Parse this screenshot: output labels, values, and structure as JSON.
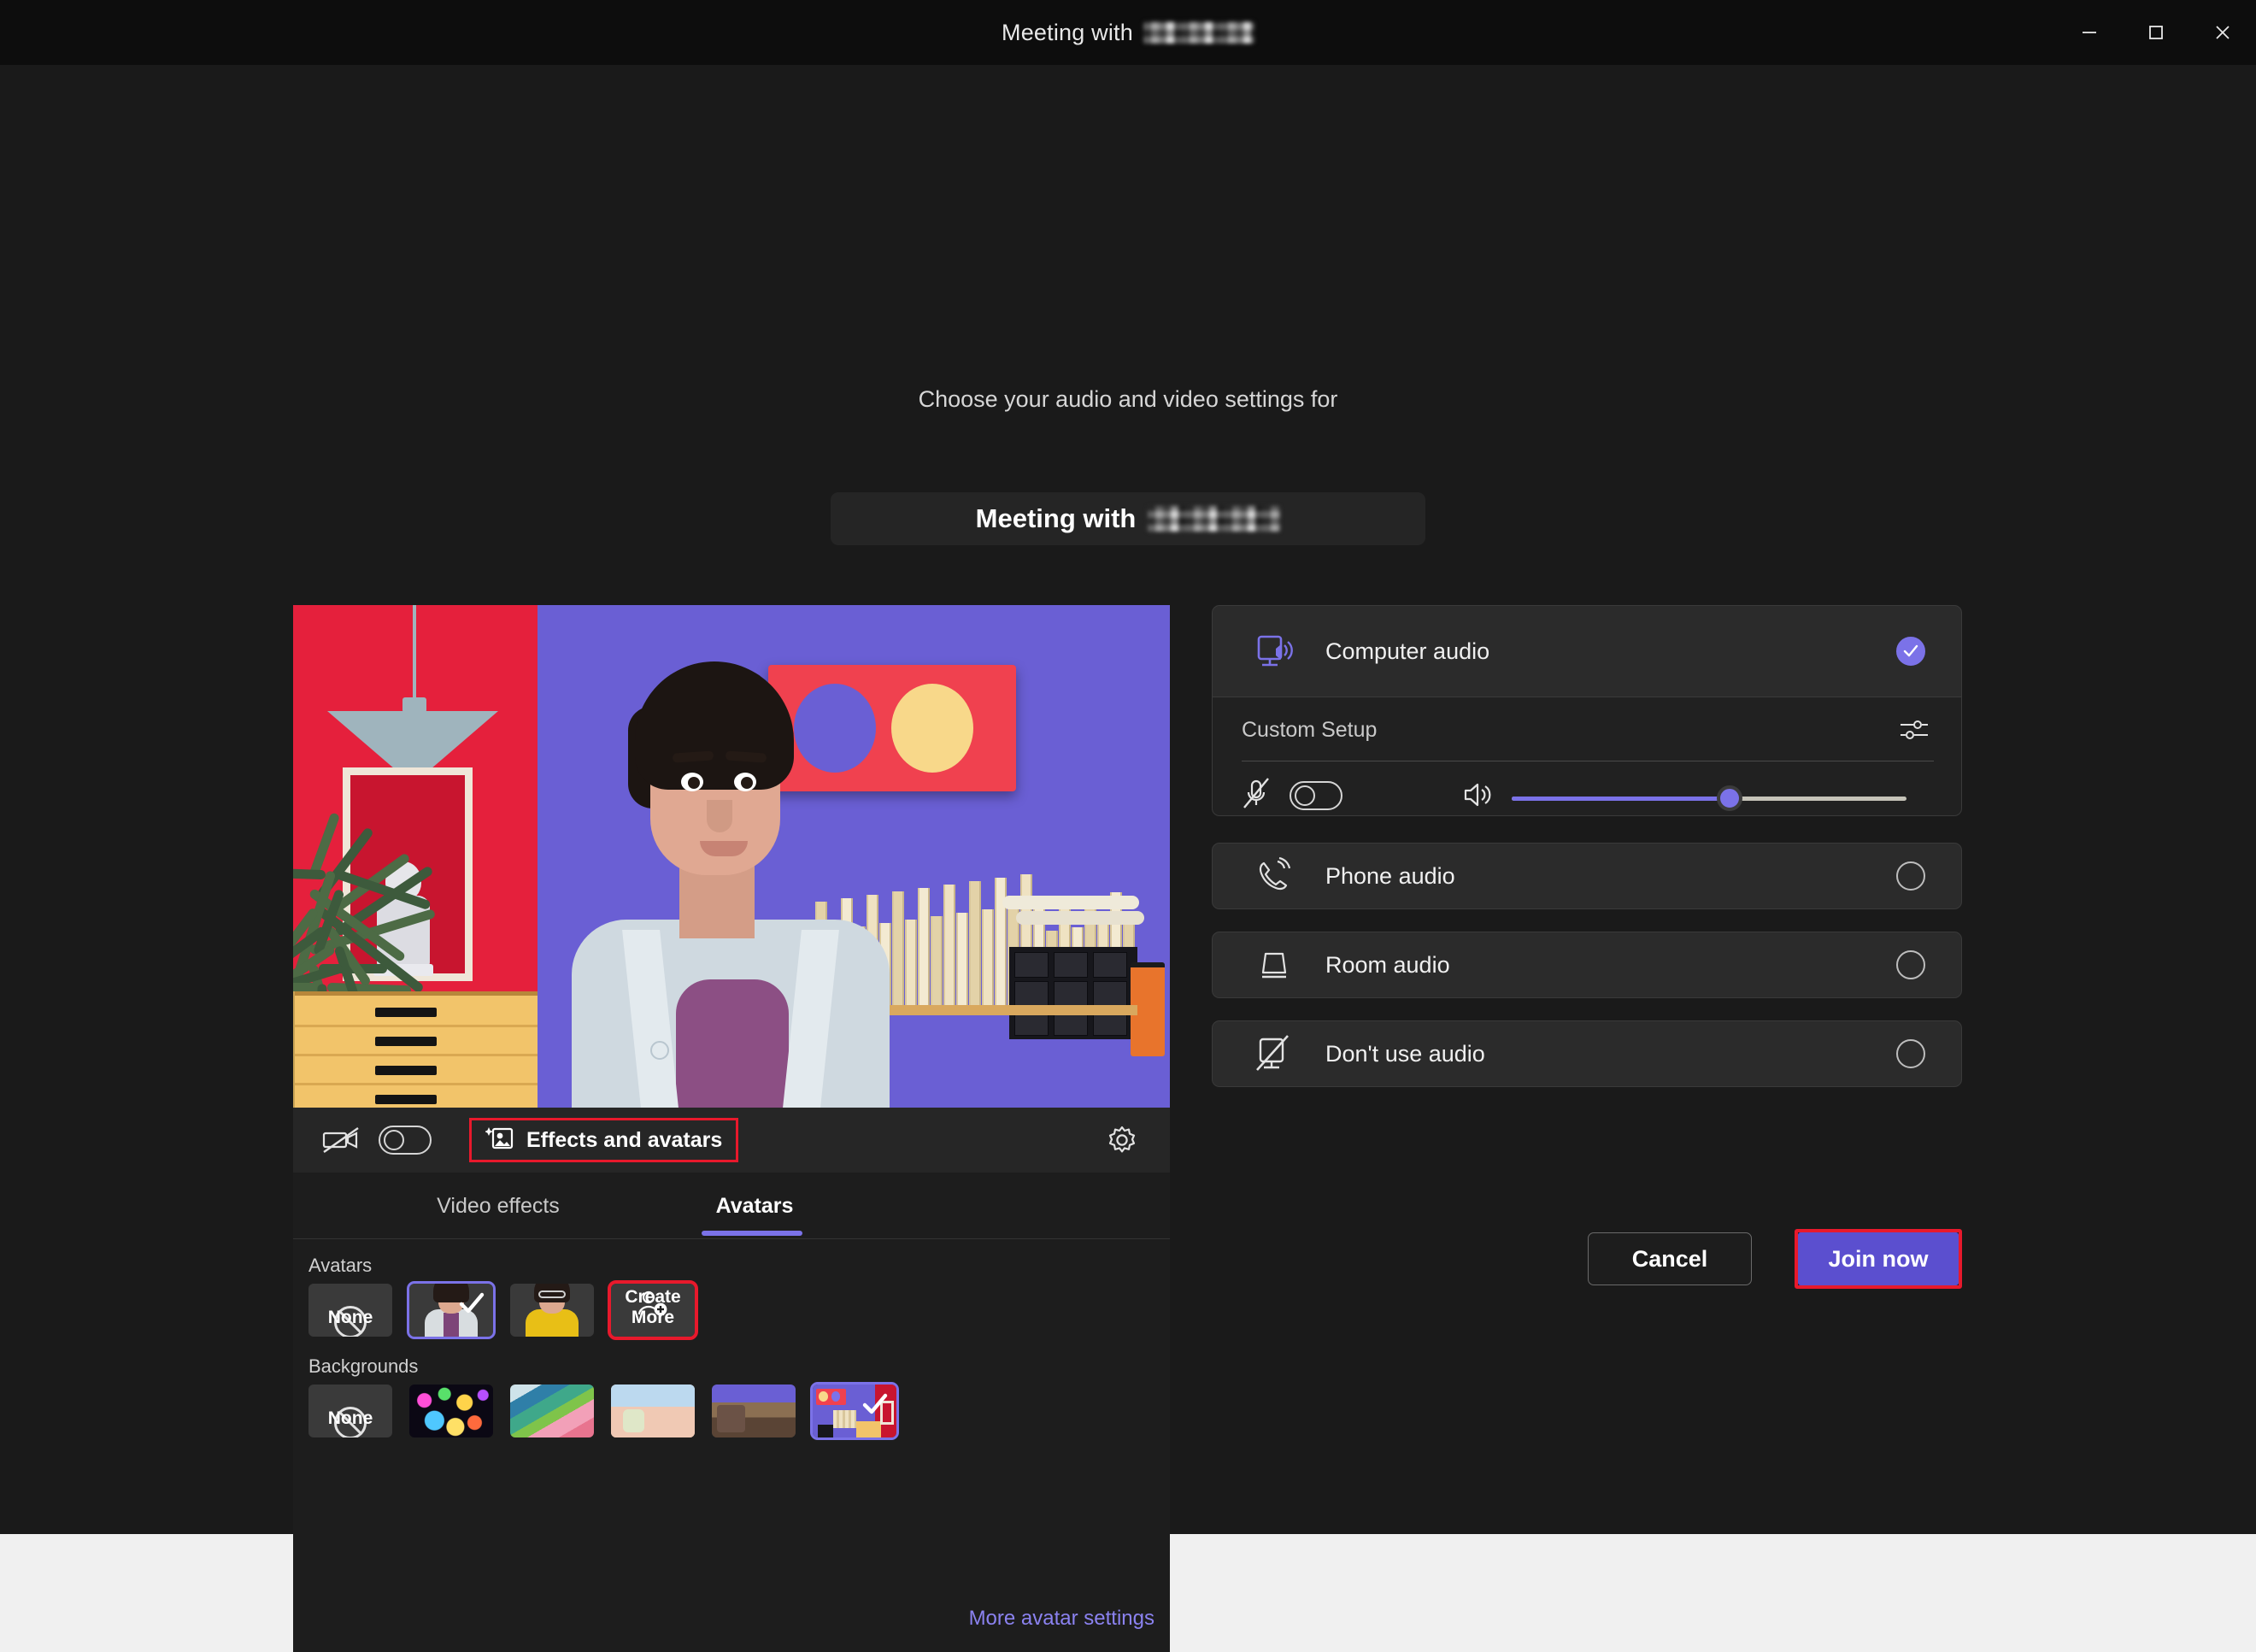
{
  "window": {
    "title_prefix": "Meeting with",
    "title_redacted": true,
    "controls": {
      "minimize": "minimize-button",
      "maximize": "maximize-button",
      "close": "close-button"
    }
  },
  "prejoin": {
    "prompt": "Choose your audio and video settings for",
    "meeting_title_prefix": "Meeting with",
    "meeting_title_redacted": true
  },
  "video_toolbar": {
    "camera_icon": "camera-off-icon",
    "camera_toggle_on": false,
    "effects_button": "Effects and avatars",
    "effects_icon": "effects-sparkle-icon",
    "settings_icon": "gear-icon",
    "effects_highlighted": true
  },
  "effects_panel": {
    "tabs": [
      {
        "label": "Video effects",
        "active": false
      },
      {
        "label": "Avatars",
        "active": true
      }
    ],
    "avatars": {
      "label": "Avatars",
      "items": [
        {
          "label": "None",
          "type": "none",
          "selected": false
        },
        {
          "label": "",
          "type": "avatar",
          "selected": true,
          "outfit": "#d8dde0",
          "inner": "#7d4478",
          "hair": "#241a16",
          "glasses": false
        },
        {
          "label": "",
          "type": "avatar",
          "selected": false,
          "outfit": "#e8bf16",
          "inner": "#e8bf16",
          "hair": "#2c2019",
          "glasses": true
        },
        {
          "label": "Create More",
          "type": "create",
          "selected": false,
          "highlighted": true,
          "icon": "person-add-icon"
        }
      ]
    },
    "backgrounds": {
      "label": "Backgrounds",
      "items": [
        {
          "label": "None",
          "type": "none",
          "selected": false
        },
        {
          "label": "",
          "type": "bokeh-lights",
          "selected": false
        },
        {
          "label": "",
          "type": "abstract-waves",
          "selected": false
        },
        {
          "label": "",
          "type": "candy-land",
          "selected": false
        },
        {
          "label": "",
          "type": "modern-living-room",
          "selected": false
        },
        {
          "label": "",
          "type": "colorful-studio",
          "selected": true
        }
      ]
    },
    "more_settings_link": "More avatar settings"
  },
  "audio": {
    "options": [
      {
        "label": "Computer audio",
        "icon": "computer-speaker-icon",
        "selected": true
      },
      {
        "label": "Phone audio",
        "icon": "phone-icon",
        "selected": false
      },
      {
        "label": "Room audio",
        "icon": "room-speaker-icon",
        "selected": false
      },
      {
        "label": "Don't use audio",
        "icon": "no-audio-icon",
        "selected": false
      }
    ],
    "custom_setup": {
      "label": "Custom Setup",
      "settings_icon": "sliders-icon",
      "mic_icon": "microphone-off-icon",
      "mic_toggle_on": false,
      "speaker_icon": "speaker-icon",
      "volume_percent": 54
    }
  },
  "actions": {
    "cancel_label": "Cancel",
    "join_label": "Join now",
    "join_highlighted": true
  },
  "colors": {
    "accent_purple": "#7b72e8",
    "join_purple": "#5b4fcf",
    "highlight_red": "#e8192c",
    "panel_bg": "#2b2b2b",
    "app_bg": "#1a1a1a"
  }
}
